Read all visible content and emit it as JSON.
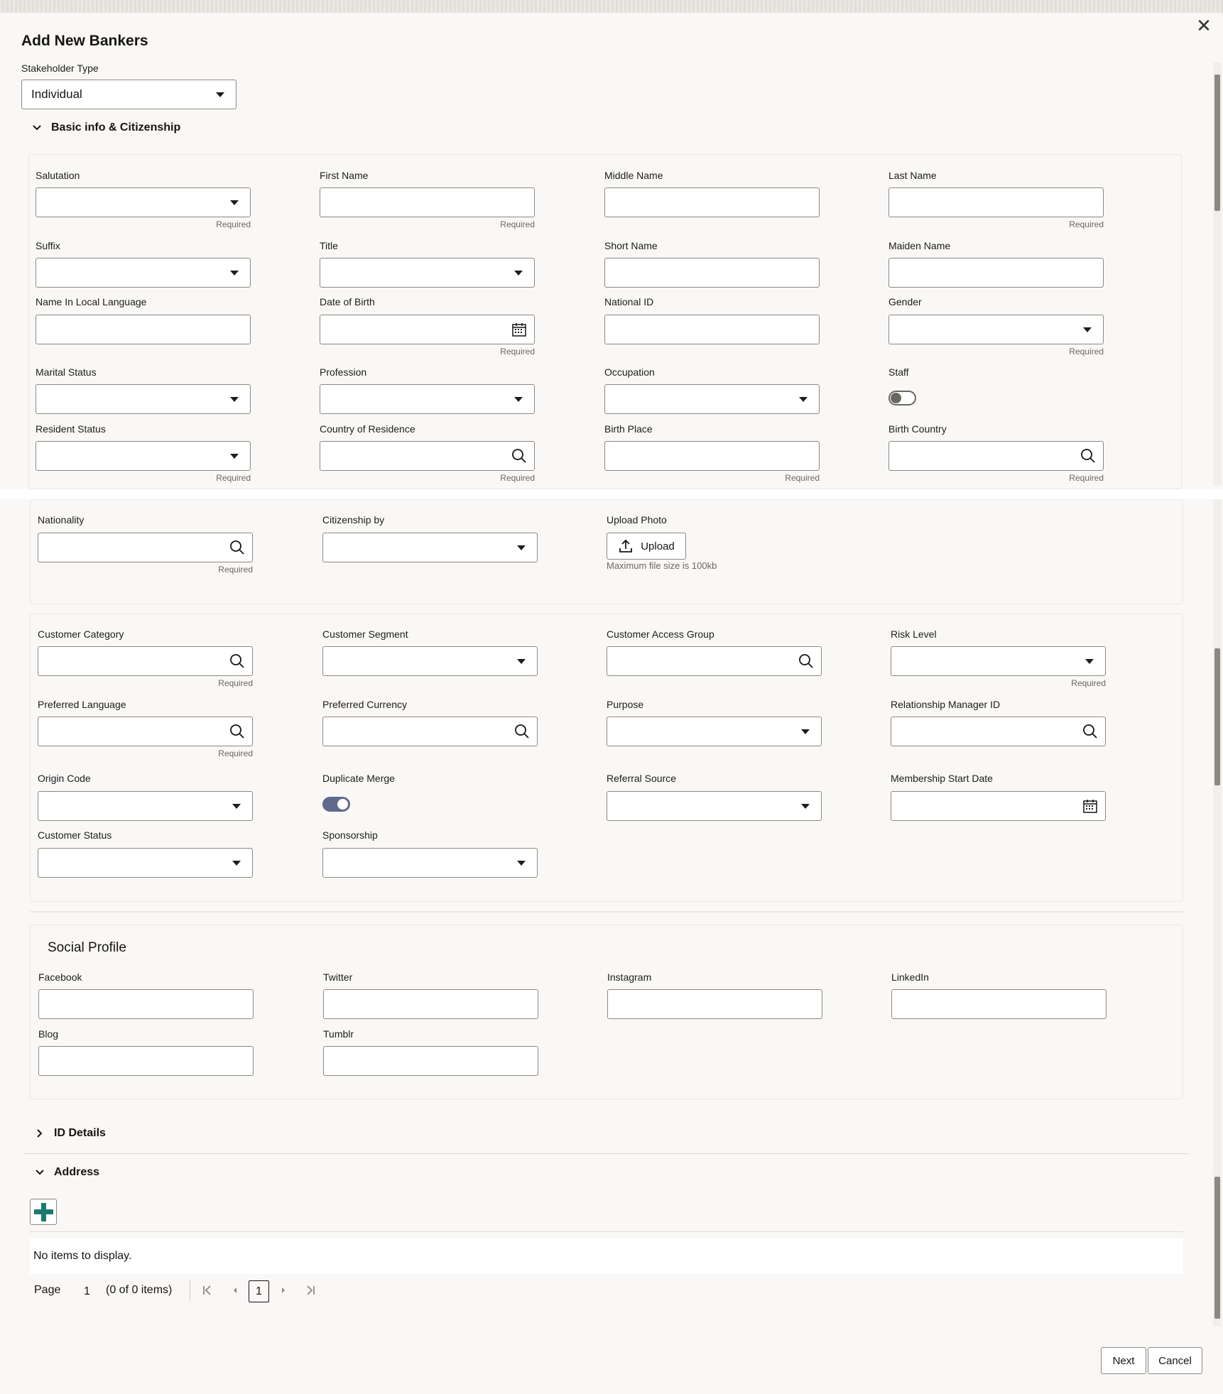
{
  "dialog": {
    "title": "Add New Bankers",
    "close_glyph": "✕"
  },
  "stakeholder": {
    "label": "Stakeholder Type",
    "value": "Individual"
  },
  "sections": {
    "basic": "Basic info & Citizenship",
    "social": "Social Profile",
    "id": "ID Details",
    "address": "Address"
  },
  "required": "Required",
  "fields": {
    "salutation": "Salutation",
    "first_name": "First Name",
    "middle_name": "Middle Name",
    "last_name": "Last Name",
    "suffix": "Suffix",
    "title": "Title",
    "short_name": "Short Name",
    "maiden_name": "Maiden Name",
    "local_name": "Name In Local Language",
    "dob": "Date of Birth",
    "national_id": "National ID",
    "gender": "Gender",
    "marital": "Marital Status",
    "profession": "Profession",
    "occupation": "Occupation",
    "staff": "Staff",
    "resident": "Resident Status",
    "country_res": "Country of Residence",
    "birth_place": "Birth Place",
    "birth_country": "Birth Country",
    "nationality": "Nationality",
    "citizenship": "Citizenship by",
    "upload_photo": "Upload Photo",
    "cust_category": "Customer Category",
    "cust_segment": "Customer Segment",
    "cust_access": "Customer Access Group",
    "risk": "Risk Level",
    "pref_lang": "Preferred Language",
    "pref_curr": "Preferred Currency",
    "purpose": "Purpose",
    "rm_id": "Relationship Manager ID",
    "origin": "Origin Code",
    "dup_merge": "Duplicate Merge",
    "referral": "Referral Source",
    "membership": "Membership Start Date",
    "cust_status": "Customer Status",
    "sponsorship": "Sponsorship",
    "facebook": "Facebook",
    "twitter": "Twitter",
    "instagram": "Instagram",
    "linkedin": "LinkedIn",
    "blog": "Blog",
    "tumblr": "Tumblr"
  },
  "upload": {
    "button": "Upload",
    "hint": "Maximum file size is 100kb"
  },
  "toggles": {
    "staff_on": false,
    "duplicate_merge_on": true
  },
  "address_table": {
    "empty": "No items to display."
  },
  "pagination": {
    "page_label": "Page",
    "page_value": "1",
    "items": "(0 of 0 items)",
    "current": "1"
  },
  "footer": {
    "next": "Next",
    "cancel": "Cancel"
  }
}
